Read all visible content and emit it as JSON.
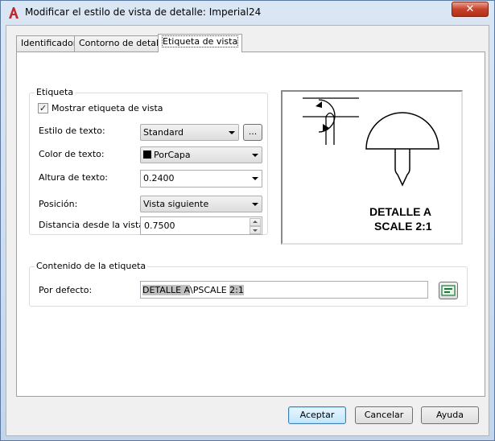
{
  "window": {
    "title": "Modificar el estilo de vista de detalle: Imperial24",
    "close_glyph": "✕"
  },
  "tabs": [
    {
      "label": "Identificador",
      "active": false
    },
    {
      "label": "Contorno de detalle",
      "active": false
    },
    {
      "label": "Etiqueta de vista",
      "active": true
    }
  ],
  "etiqueta_group": {
    "title": "Etiqueta",
    "show_label": {
      "label": "Mostrar etiqueta de vista",
      "checked": true,
      "check_glyph": "✓"
    },
    "text_style": {
      "label": "Estilo de texto:",
      "value": "Standard",
      "browse_label": "..."
    },
    "text_color": {
      "label": "Color de texto:",
      "value": "PorCapa",
      "swatch": "#000000"
    },
    "text_height": {
      "label": "Altura de texto:",
      "value": "0.2400"
    },
    "position": {
      "label": "Posición:",
      "value": "Vista siguiente"
    },
    "distance": {
      "label": "Distancia desde la vista:",
      "value": "0.7500"
    }
  },
  "preview": {
    "line1": "DETALLE A",
    "line2": "SCALE 2:1"
  },
  "contenido_group": {
    "title": "Contenido de la etiqueta",
    "default_label": "Por defecto:",
    "value_parts": [
      "DETALLE ",
      "A",
      "\\PSCALE ",
      "2:1"
    ]
  },
  "buttons": {
    "ok": "Aceptar",
    "cancel": "Cancelar",
    "help": "Ayuda"
  },
  "colors": {
    "app_icon_red": "#c1272d",
    "close_red": "#c6412a",
    "field_edit_icon": "#1b7a3a"
  }
}
